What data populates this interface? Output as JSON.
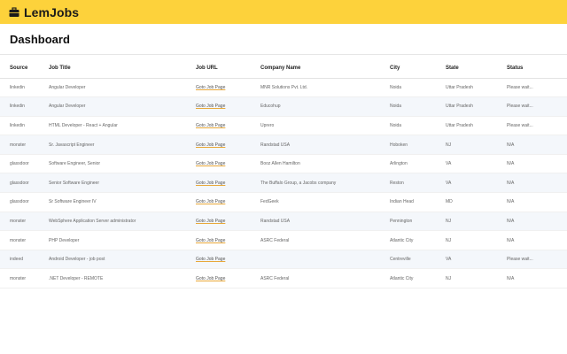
{
  "app": {
    "name": "LemJobs",
    "icon": "briefcase-icon",
    "accent": "#fdd23b"
  },
  "page": {
    "title": "Dashboard"
  },
  "table": {
    "headers": [
      "Source",
      "Job Title",
      "Job URL",
      "Company Name",
      "City",
      "State",
      "Status"
    ],
    "rows": [
      {
        "source": "linkedin",
        "title": "Angular Developer",
        "url": "Goto Job Page",
        "company": "MNR Solutions Pvt. Ltd.",
        "city": "Noida",
        "state": "Uttar Pradesh",
        "status": "Please wait..."
      },
      {
        "source": "linkedin",
        "title": "Angular Developer",
        "url": "Goto Job Page",
        "company": "Educohup",
        "city": "Noida",
        "state": "Uttar Pradesh",
        "status": "Please wait..."
      },
      {
        "source": "linkedin",
        "title": "HTML Developer - React + Angular",
        "url": "Goto Job Page",
        "company": "Uprero",
        "city": "Noida",
        "state": "Uttar Pradesh",
        "status": "Please wait..."
      },
      {
        "source": "monster",
        "title": "Sr. Javascript Engineer",
        "url": "Goto Job Page",
        "company": "Randstad USA",
        "city": "Hoboken",
        "state": "NJ",
        "status": "N/A"
      },
      {
        "source": "glassdoor",
        "title": "Software Engineer, Senior",
        "url": "Goto Job Page",
        "company": "Booz Allen Hamilton",
        "city": "Arlington",
        "state": "VA",
        "status": "N/A"
      },
      {
        "source": "glassdoor",
        "title": "Senior Software Engineer",
        "url": "Goto Job Page",
        "company": "The Buffalo Group, a Jacobs company",
        "city": "Reston",
        "state": "VA",
        "status": "N/A"
      },
      {
        "source": "glassdoor",
        "title": "Sr Software Engineer IV",
        "url": "Goto Job Page",
        "company": "FedGeek",
        "city": "Indian Head",
        "state": "MD",
        "status": "N/A"
      },
      {
        "source": "monster",
        "title": "WebSphere Application Server administrator",
        "url": "Goto Job Page",
        "company": "Randstad USA",
        "city": "Pennington",
        "state": "NJ",
        "status": "N/A"
      },
      {
        "source": "monster",
        "title": "PHP Developer",
        "url": "Goto Job Page",
        "company": "ASRC Federal",
        "city": "Atlantic City",
        "state": "NJ",
        "status": "N/A"
      },
      {
        "source": "indeed",
        "title": "Android Developer - job post",
        "url": "Goto Job Page",
        "company": "",
        "city": "Centreville",
        "state": "VA",
        "status": "Please wait..."
      },
      {
        "source": "monster",
        "title": ".NET Developer - REMOTE",
        "url": "Goto Job Page",
        "company": "ASRC Federal",
        "city": "Atlantic City",
        "state": "NJ",
        "status": "N/A"
      }
    ]
  }
}
